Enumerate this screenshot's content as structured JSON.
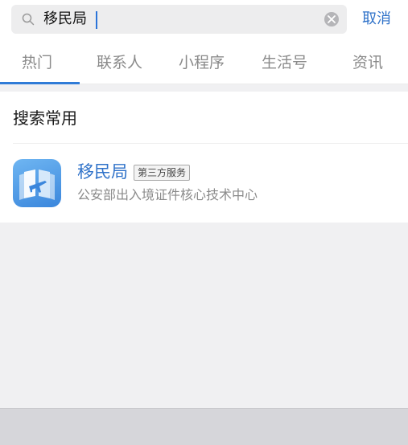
{
  "search": {
    "query": "移民局",
    "cancel_label": "取消"
  },
  "tabs": [
    {
      "label": "热门",
      "active": true
    },
    {
      "label": "联系人",
      "active": false
    },
    {
      "label": "小程序",
      "active": false
    },
    {
      "label": "生活号",
      "active": false
    },
    {
      "label": "资讯",
      "active": false
    }
  ],
  "section": {
    "title": "搜索常用",
    "results": [
      {
        "name": "移民局",
        "badge": "第三方服务",
        "description": "公安部出入境证件核心技术中心",
        "icon": "passport-plane-icon"
      }
    ]
  },
  "colors": {
    "accent": "#2f72c9",
    "tab_underline": "#2f7bd7",
    "icon_gradient_start": "#6fb6f2",
    "icon_gradient_end": "#3a86dc"
  }
}
